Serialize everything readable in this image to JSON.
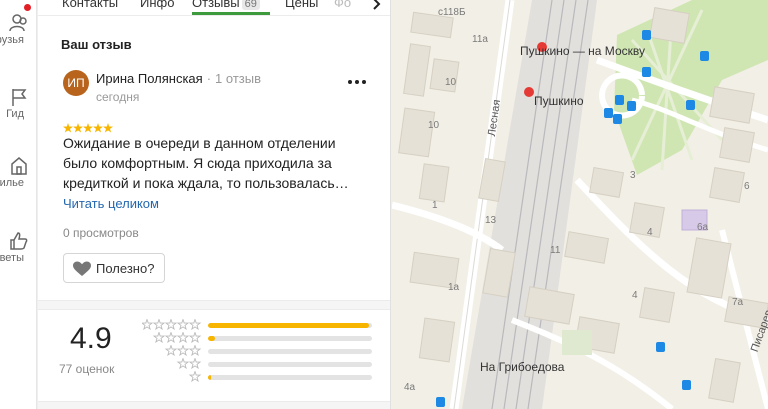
{
  "rail": {
    "items": [
      {
        "label": "рузья"
      },
      {
        "label": "Гид"
      },
      {
        "label": "илье"
      },
      {
        "label": "веты"
      }
    ]
  },
  "tabs": [
    {
      "label": "Контакты"
    },
    {
      "label": "Инфо"
    },
    {
      "label": "Отзывы",
      "count": "69"
    },
    {
      "label": "Цены"
    },
    {
      "label": "Фо"
    }
  ],
  "review": {
    "section_title": "Ваш отзыв",
    "avatar_initials": "ИП",
    "author": "Ирина Полянская",
    "author_reviews": "1 отзыв",
    "date": "сегодня",
    "rating": 5,
    "text": "Ожидание в очереди в данном отделении было комфортным. Я сюда приходила за кредиткой и пока ждала, то пользовалась…",
    "read_more": "Читать целиком",
    "views": "0 просмотров",
    "helpful": "Полезно?"
  },
  "rating_summary": {
    "score": "4.9",
    "count_label": "77 оценок",
    "distribution": [
      {
        "stars": 5,
        "fraction": 0.98
      },
      {
        "stars": 4,
        "fraction": 0.04
      },
      {
        "stars": 3,
        "fraction": 0.0
      },
      {
        "stars": 2,
        "fraction": 0.0
      },
      {
        "stars": 1,
        "fraction": 0.02
      }
    ]
  },
  "map": {
    "labels": {
      "station_moscow": "Пушкино — на Москву",
      "station": "Пушкино",
      "street_lesnaya": "Лесная",
      "street_griboedova": "На Грибоедова",
      "street_pisarev": "Писарев"
    },
    "numbers": [
      "с118Б",
      "11а",
      "10",
      "10",
      "1",
      "13",
      "11",
      "1а",
      "3",
      "4",
      "6а",
      "4",
      "7а",
      "4а",
      "6"
    ]
  },
  "colors": {
    "accent_green": "#3d9a3d",
    "star_yellow": "#f7b500",
    "link_blue": "#2467b0",
    "avatar_brown": "#b8641c"
  }
}
